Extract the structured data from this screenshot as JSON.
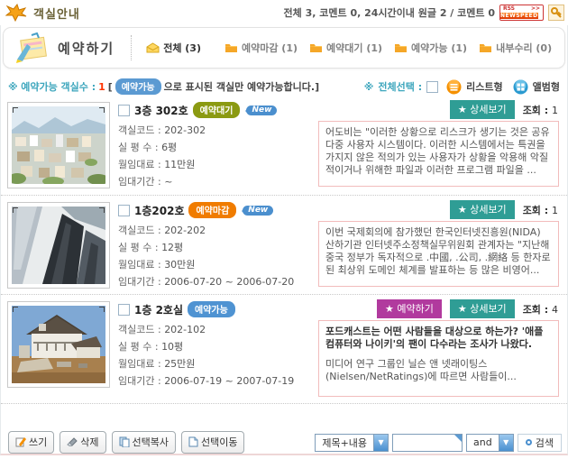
{
  "header": {
    "title": "객실안내",
    "stats": "전체 3, 코멘트 0,  24시간이내 원글 2 / 코멘트 0",
    "rss_top": "RSS",
    "rss_arrows": ">>",
    "rss_bottom": "NEWSPEED"
  },
  "board": {
    "title": "예약하기",
    "tabs": [
      {
        "label": "전체 (3)"
      },
      {
        "label": "예약마감 (1)"
      },
      {
        "label": "예약대기 (1)"
      },
      {
        "label": "예약가능 (1)"
      },
      {
        "label": "내부수리 (0)"
      }
    ]
  },
  "filter": {
    "marker": "※",
    "available_prefix": "예약가능 객실수 :",
    "available_count": "1",
    "bracket_open": "[",
    "available_badge": "예약가능",
    "available_suffix": "으로 표시된 객실만 예약가능합니다.]",
    "select_all_label": "전체선택 :",
    "list_view_label": "리스트형",
    "album_view_label": "앨범형"
  },
  "rooms": [
    {
      "title": "3층 302호",
      "status": "예약대기",
      "status_color": "#8b9a12",
      "new_label": "New",
      "fields": [
        {
          "label": "객실코드 : ",
          "value": "202-302"
        },
        {
          "label": "실 평 수 :  ",
          "value": "6평"
        },
        {
          "label": "월임대료 : ",
          "value": "11만원"
        },
        {
          "label": "임대기간 :  ",
          "value": "~"
        }
      ],
      "detail_button": "★ 상세보기",
      "views_label": "조회 : ",
      "views": "1",
      "description": "어도비는 \"이러한 상황으로 리스크가 생기는 것은 공유 다중 사용자 시스템이다. 이러한 시스템에서는 특권을 가지지 않은 적의가 있는 사용자가 상황을 악용해 악질적이거나 위해한 파일과 이러한 프로그램 파일을 ..."
    },
    {
      "title": "1층202호",
      "status": "예약마감",
      "status_color": "#f07c00",
      "new_label": "New",
      "fields": [
        {
          "label": "객실코드 : ",
          "value": "202-202"
        },
        {
          "label": "실 평 수 :  ",
          "value": "12평"
        },
        {
          "label": "월임대료 : ",
          "value": "30만원"
        },
        {
          "label": "임대기간 : ",
          "value": "2006-07-20 ~ 2006-07-20"
        }
      ],
      "detail_button": "★ 상세보기",
      "views_label": "조회 : ",
      "views": "1",
      "description": "이번 국제회의에 참가했던 한국인터넷진흥원(NIDA) 산하기관 인터넷주소정책실무위원회 관계자는 \"지난해 중국 정부가 독자적으로 .中國, .公司, .網絡 등 한자로 된 최상위 도메인 체계를 발표하는 등 많은 비영어..."
    },
    {
      "title": "1층 2호실",
      "status": "예약가능",
      "status_color": "#4f93d2",
      "fields": [
        {
          "label": "객실코드 : ",
          "value": "202-102"
        },
        {
          "label": "실 평 수 :  ",
          "value": "10평"
        },
        {
          "label": "월임대료 : ",
          "value": "25만원"
        },
        {
          "label": "임대기간 : ",
          "value": "2006-07-19 ~ 2007-07-19"
        }
      ],
      "reserve_button": "★ 예약하기",
      "detail_button": "★ 상세보기",
      "views_label": "조회 : ",
      "views": "4",
      "description_lead": "포드캐스트는 어떤 사람들을 대상으로 하는가? '애플 컴퓨터와 나이키'의 팬이 다수라는 조사가 나왔다.",
      "description": "미디어 연구 그룹인 닐슨 앤 넷래이팅스 (Nielsen/NetRatings)에 따르면 사람들이..."
    }
  ],
  "toolbar": {
    "write": "쓰기",
    "delete": "삭제",
    "copy": "선택복사",
    "move": "선택이동"
  },
  "search": {
    "field": "제목+내용",
    "operator": "and",
    "button": "검색"
  },
  "colors": {
    "teal_button": "#2f9d95",
    "magenta_button": "#b13a9e",
    "badge_blue": "#5b9ad2",
    "status_wait": "#8b9a12",
    "status_closed": "#f07c00",
    "status_open": "#4f93d2"
  }
}
